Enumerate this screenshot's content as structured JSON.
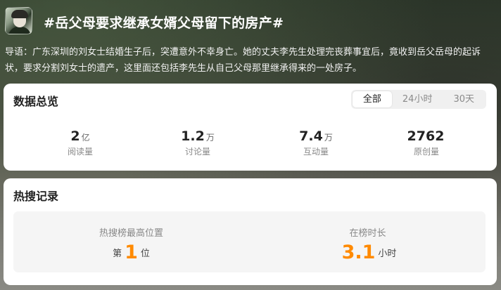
{
  "header": {
    "title": "#岳父母要求继承女婿父母留下的房产#"
  },
  "intro": "导语：广东深圳的刘女士结婚生子后，突遭意外不幸身亡。她的丈夫李先生处理完丧葬事宜后，竟收到岳父岳母的起诉状，要求分割刘女士的遗产，这里面还包括李先生从自己父母那里继承得来的一处房子。",
  "overview": {
    "title": "数据总览",
    "tabs": [
      "全部",
      "24小时",
      "30天"
    ],
    "stats": [
      {
        "value": "2",
        "unit": "亿",
        "label": "阅读量"
      },
      {
        "value": "1.2",
        "unit": "万",
        "label": "讨论量"
      },
      {
        "value": "7.4",
        "unit": "万",
        "label": "互动量"
      },
      {
        "value": "2762",
        "unit": "",
        "label": "原创量"
      }
    ]
  },
  "hot": {
    "title": "热搜记录",
    "position": {
      "caption": "热搜榜最高位置",
      "prefix": "第",
      "value": "1",
      "suffix": "位"
    },
    "duration": {
      "caption": "在榜时长",
      "value": "3.1",
      "suffix": "小时"
    }
  },
  "colors": {
    "accent": "#ff8a00"
  }
}
